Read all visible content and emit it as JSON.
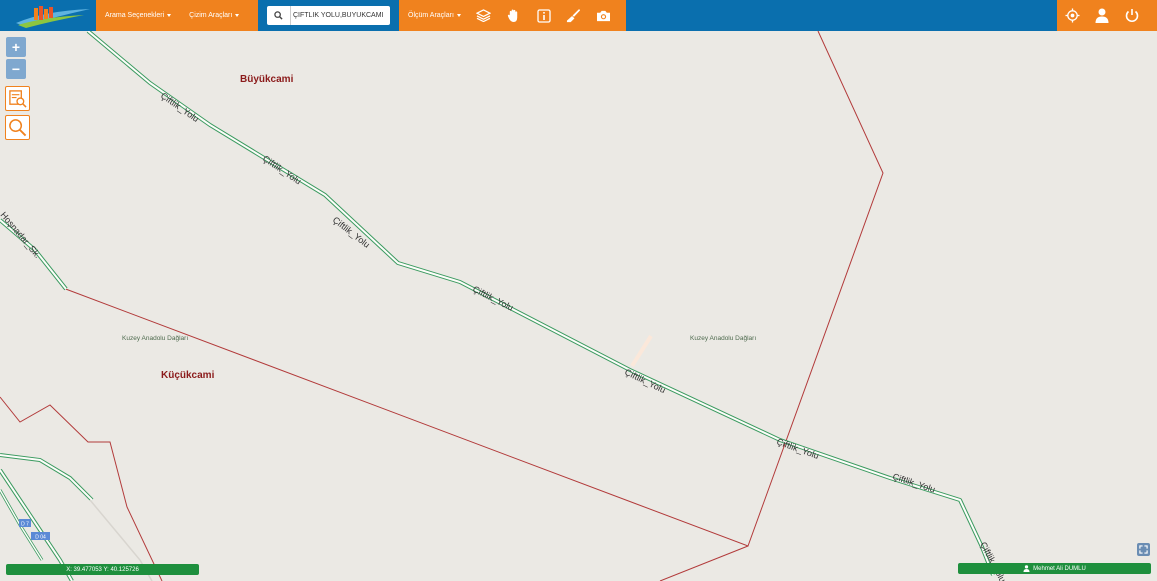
{
  "toolbar": {
    "search_options": "Arama Seçenekleri",
    "drawing_tools": "Çizim Araçları",
    "measure_tools": "Ölçüm Araçları",
    "search_value": "ÇİFTLİK YOLU,BÜYÜKCAMİ"
  },
  "map": {
    "places": [
      "Büyükcami",
      "Küçükcami"
    ],
    "natural_labels": [
      "Kuzey Anadolu Dağları",
      "Kuzey Anadolu Dağları"
    ],
    "road_name": "Çiftlik_Yolu",
    "street_name": "Hoşnadar_Sk.",
    "road_badge": "D 7",
    "road_badge_2": "D 04"
  },
  "zoom": {
    "in": "+",
    "out": "−"
  },
  "status": {
    "coordinates": "X: 39.477053 Y: 40.125726",
    "user": "Mehmet Ali DUMLU"
  },
  "colors": {
    "header": "#0a6fae",
    "accent": "#f0821e",
    "status": "#1e8f3d",
    "boundary": "#b23a3a",
    "road": "#3a9a5f"
  }
}
